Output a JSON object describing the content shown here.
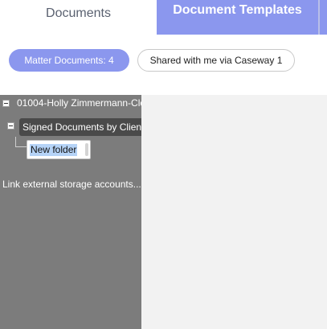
{
  "tabs": [
    {
      "label": "Documents",
      "active": false
    },
    {
      "label": "Document Templates",
      "active": true
    }
  ],
  "filters": [
    {
      "label": "Matter Documents: 4",
      "selected": true
    },
    {
      "label": "Shared with me via Caseway 1",
      "selected": false
    }
  ],
  "tree": {
    "root": {
      "label": "01004-Holly Zimmermann-Clo"
    },
    "child": {
      "label": "Signed Documents by Client"
    },
    "editing_node": {
      "value": "New folder"
    }
  },
  "link_storage": {
    "label": "Link external storage accounts..."
  },
  "colors": {
    "accent": "#8b97ee",
    "tree_panel": "#7c7c7c",
    "selected_node": "#4a4a4a",
    "content_bg": "#f2f2f2"
  },
  "icons": {
    "collapse": "minus-square-icon"
  }
}
